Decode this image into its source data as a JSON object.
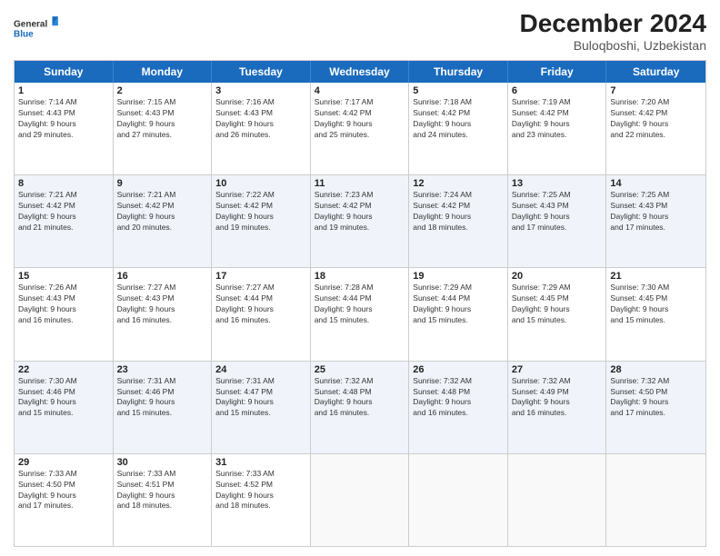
{
  "header": {
    "title": "December 2024",
    "location": "Buloqboshi, Uzbekistan",
    "logo_general": "General",
    "logo_blue": "Blue"
  },
  "weekdays": [
    "Sunday",
    "Monday",
    "Tuesday",
    "Wednesday",
    "Thursday",
    "Friday",
    "Saturday"
  ],
  "rows": [
    {
      "cells": [
        {
          "day": "1",
          "sunrise": "7:14 AM",
          "sunset": "4:43 PM",
          "daylight_h": "9",
          "daylight_m": "29"
        },
        {
          "day": "2",
          "sunrise": "7:15 AM",
          "sunset": "4:43 PM",
          "daylight_h": "9",
          "daylight_m": "27"
        },
        {
          "day": "3",
          "sunrise": "7:16 AM",
          "sunset": "4:43 PM",
          "daylight_h": "9",
          "daylight_m": "26"
        },
        {
          "day": "4",
          "sunrise": "7:17 AM",
          "sunset": "4:42 PM",
          "daylight_h": "9",
          "daylight_m": "25"
        },
        {
          "day": "5",
          "sunrise": "7:18 AM",
          "sunset": "4:42 PM",
          "daylight_h": "9",
          "daylight_m": "24"
        },
        {
          "day": "6",
          "sunrise": "7:19 AM",
          "sunset": "4:42 PM",
          "daylight_h": "9",
          "daylight_m": "23"
        },
        {
          "day": "7",
          "sunrise": "7:20 AM",
          "sunset": "4:42 PM",
          "daylight_h": "9",
          "daylight_m": "22"
        }
      ]
    },
    {
      "cells": [
        {
          "day": "8",
          "sunrise": "7:21 AM",
          "sunset": "4:42 PM",
          "daylight_h": "9",
          "daylight_m": "21"
        },
        {
          "day": "9",
          "sunrise": "7:21 AM",
          "sunset": "4:42 PM",
          "daylight_h": "9",
          "daylight_m": "20"
        },
        {
          "day": "10",
          "sunrise": "7:22 AM",
          "sunset": "4:42 PM",
          "daylight_h": "9",
          "daylight_m": "19"
        },
        {
          "day": "11",
          "sunrise": "7:23 AM",
          "sunset": "4:42 PM",
          "daylight_h": "9",
          "daylight_m": "19"
        },
        {
          "day": "12",
          "sunrise": "7:24 AM",
          "sunset": "4:42 PM",
          "daylight_h": "9",
          "daylight_m": "18"
        },
        {
          "day": "13",
          "sunrise": "7:25 AM",
          "sunset": "4:43 PM",
          "daylight_h": "9",
          "daylight_m": "17"
        },
        {
          "day": "14",
          "sunrise": "7:25 AM",
          "sunset": "4:43 PM",
          "daylight_h": "9",
          "daylight_m": "17"
        }
      ]
    },
    {
      "cells": [
        {
          "day": "15",
          "sunrise": "7:26 AM",
          "sunset": "4:43 PM",
          "daylight_h": "9",
          "daylight_m": "16"
        },
        {
          "day": "16",
          "sunrise": "7:27 AM",
          "sunset": "4:43 PM",
          "daylight_h": "9",
          "daylight_m": "16"
        },
        {
          "day": "17",
          "sunrise": "7:27 AM",
          "sunset": "4:44 PM",
          "daylight_h": "9",
          "daylight_m": "16"
        },
        {
          "day": "18",
          "sunrise": "7:28 AM",
          "sunset": "4:44 PM",
          "daylight_h": "9",
          "daylight_m": "15"
        },
        {
          "day": "19",
          "sunrise": "7:29 AM",
          "sunset": "4:44 PM",
          "daylight_h": "9",
          "daylight_m": "15"
        },
        {
          "day": "20",
          "sunrise": "7:29 AM",
          "sunset": "4:45 PM",
          "daylight_h": "9",
          "daylight_m": "15"
        },
        {
          "day": "21",
          "sunrise": "7:30 AM",
          "sunset": "4:45 PM",
          "daylight_h": "9",
          "daylight_m": "15"
        }
      ]
    },
    {
      "cells": [
        {
          "day": "22",
          "sunrise": "7:30 AM",
          "sunset": "4:46 PM",
          "daylight_h": "9",
          "daylight_m": "15"
        },
        {
          "day": "23",
          "sunrise": "7:31 AM",
          "sunset": "4:46 PM",
          "daylight_h": "9",
          "daylight_m": "15"
        },
        {
          "day": "24",
          "sunrise": "7:31 AM",
          "sunset": "4:47 PM",
          "daylight_h": "9",
          "daylight_m": "15"
        },
        {
          "day": "25",
          "sunrise": "7:32 AM",
          "sunset": "4:48 PM",
          "daylight_h": "9",
          "daylight_m": "16"
        },
        {
          "day": "26",
          "sunrise": "7:32 AM",
          "sunset": "4:48 PM",
          "daylight_h": "9",
          "daylight_m": "16"
        },
        {
          "day": "27",
          "sunrise": "7:32 AM",
          "sunset": "4:49 PM",
          "daylight_h": "9",
          "daylight_m": "16"
        },
        {
          "day": "28",
          "sunrise": "7:32 AM",
          "sunset": "4:50 PM",
          "daylight_h": "9",
          "daylight_m": "17"
        }
      ]
    },
    {
      "cells": [
        {
          "day": "29",
          "sunrise": "7:33 AM",
          "sunset": "4:50 PM",
          "daylight_h": "9",
          "daylight_m": "17"
        },
        {
          "day": "30",
          "sunrise": "7:33 AM",
          "sunset": "4:51 PM",
          "daylight_h": "9",
          "daylight_m": "18"
        },
        {
          "day": "31",
          "sunrise": "7:33 AM",
          "sunset": "4:52 PM",
          "daylight_h": "9",
          "daylight_m": "18"
        },
        {
          "day": "",
          "empty": true
        },
        {
          "day": "",
          "empty": true
        },
        {
          "day": "",
          "empty": true
        },
        {
          "day": "",
          "empty": true
        }
      ]
    }
  ]
}
